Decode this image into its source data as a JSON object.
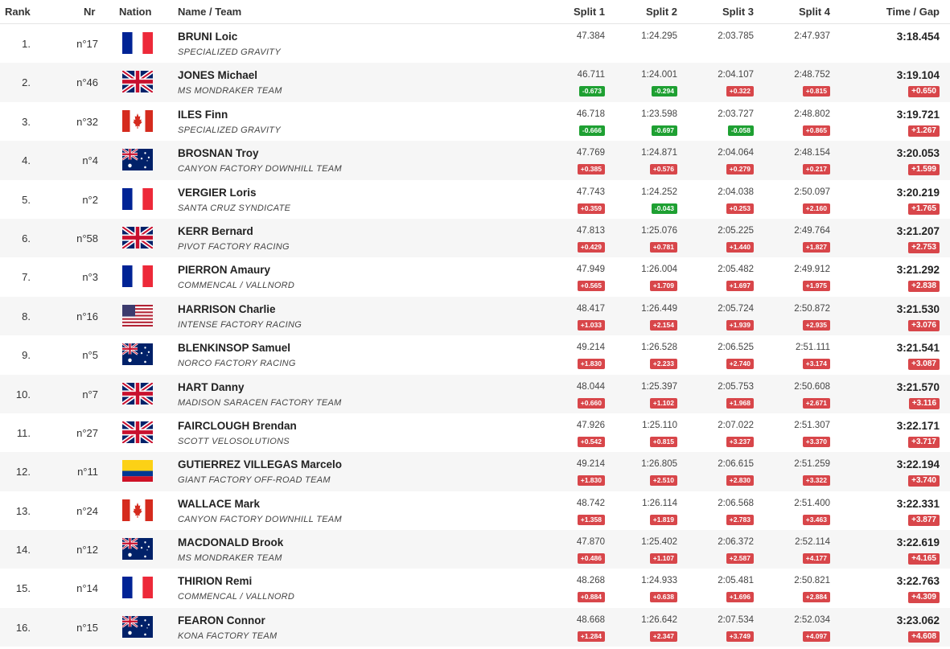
{
  "header": {
    "rank": "Rank",
    "nr": "Nr",
    "nation": "Nation",
    "name_team": "Name / Team",
    "split1": "Split 1",
    "split2": "Split 2",
    "split3": "Split 3",
    "split4": "Split 4",
    "time_gap": "Time / Gap"
  },
  "colors": {
    "behind": "#d8464a",
    "ahead": "#1ea032",
    "alt_row": "#f6f6f6"
  },
  "rows": [
    {
      "rank": "1.",
      "nr": "n°17",
      "nation": "fr",
      "name": "BRUNI Loic",
      "team": "SPECIALIZED GRAVITY",
      "s1": "47.384",
      "s1g": "",
      "s2": "1:24.295",
      "s2g": "",
      "s3": "2:03.785",
      "s3g": "",
      "s4": "2:47.937",
      "s4g": "",
      "time": "3:18.454",
      "gap": ""
    },
    {
      "rank": "2.",
      "nr": "n°46",
      "nation": "gb",
      "name": "JONES Michael",
      "team": "MS MONDRAKER TEAM",
      "s1": "46.711",
      "s1g": "-0.673",
      "s2": "1:24.001",
      "s2g": "-0.294",
      "s3": "2:04.107",
      "s3g": "+0.322",
      "s4": "2:48.752",
      "s4g": "+0.815",
      "time": "3:19.104",
      "gap": "+0.650"
    },
    {
      "rank": "3.",
      "nr": "n°32",
      "nation": "ca",
      "name": "ILES Finn",
      "team": "SPECIALIZED GRAVITY",
      "s1": "46.718",
      "s1g": "-0.666",
      "s2": "1:23.598",
      "s2g": "-0.697",
      "s3": "2:03.727",
      "s3g": "-0.058",
      "s4": "2:48.802",
      "s4g": "+0.865",
      "time": "3:19.721",
      "gap": "+1.267"
    },
    {
      "rank": "4.",
      "nr": "n°4",
      "nation": "au",
      "name": "BROSNAN Troy",
      "team": "CANYON FACTORY DOWNHILL TEAM",
      "s1": "47.769",
      "s1g": "+0.385",
      "s2": "1:24.871",
      "s2g": "+0.576",
      "s3": "2:04.064",
      "s3g": "+0.279",
      "s4": "2:48.154",
      "s4g": "+0.217",
      "time": "3:20.053",
      "gap": "+1.599"
    },
    {
      "rank": "5.",
      "nr": "n°2",
      "nation": "fr",
      "name": "VERGIER Loris",
      "team": "SANTA CRUZ SYNDICATE",
      "s1": "47.743",
      "s1g": "+0.359",
      "s2": "1:24.252",
      "s2g": "-0.043",
      "s3": "2:04.038",
      "s3g": "+0.253",
      "s4": "2:50.097",
      "s4g": "+2.160",
      "time": "3:20.219",
      "gap": "+1.765"
    },
    {
      "rank": "6.",
      "nr": "n°58",
      "nation": "gb",
      "name": "KERR Bernard",
      "team": "PIVOT FACTORY RACING",
      "s1": "47.813",
      "s1g": "+0.429",
      "s2": "1:25.076",
      "s2g": "+0.781",
      "s3": "2:05.225",
      "s3g": "+1.440",
      "s4": "2:49.764",
      "s4g": "+1.827",
      "time": "3:21.207",
      "gap": "+2.753"
    },
    {
      "rank": "7.",
      "nr": "n°3",
      "nation": "fr",
      "name": "PIERRON Amaury",
      "team": "COMMENCAL / VALLNORD",
      "s1": "47.949",
      "s1g": "+0.565",
      "s2": "1:26.004",
      "s2g": "+1.709",
      "s3": "2:05.482",
      "s3g": "+1.697",
      "s4": "2:49.912",
      "s4g": "+1.975",
      "time": "3:21.292",
      "gap": "+2.838"
    },
    {
      "rank": "8.",
      "nr": "n°16",
      "nation": "us",
      "name": "HARRISON Charlie",
      "team": "INTENSE FACTORY RACING",
      "s1": "48.417",
      "s1g": "+1.033",
      "s2": "1:26.449",
      "s2g": "+2.154",
      "s3": "2:05.724",
      "s3g": "+1.939",
      "s4": "2:50.872",
      "s4g": "+2.935",
      "time": "3:21.530",
      "gap": "+3.076"
    },
    {
      "rank": "9.",
      "nr": "n°5",
      "nation": "au",
      "name": "BLENKINSOP Samuel",
      "team": "NORCO FACTORY RACING",
      "s1": "49.214",
      "s1g": "+1.830",
      "s2": "1:26.528",
      "s2g": "+2.233",
      "s3": "2:06.525",
      "s3g": "+2.740",
      "s4": "2:51.111",
      "s4g": "+3.174",
      "time": "3:21.541",
      "gap": "+3.087"
    },
    {
      "rank": "10.",
      "nr": "n°7",
      "nation": "gb",
      "name": "HART Danny",
      "team": "MADISON SARACEN FACTORY TEAM",
      "s1": "48.044",
      "s1g": "+0.660",
      "s2": "1:25.397",
      "s2g": "+1.102",
      "s3": "2:05.753",
      "s3g": "+1.968",
      "s4": "2:50.608",
      "s4g": "+2.671",
      "time": "3:21.570",
      "gap": "+3.116"
    },
    {
      "rank": "11.",
      "nr": "n°27",
      "nation": "gb",
      "name": "FAIRCLOUGH Brendan",
      "team": "SCOTT VELOSOLUTIONS",
      "s1": "47.926",
      "s1g": "+0.542",
      "s2": "1:25.110",
      "s2g": "+0.815",
      "s3": "2:07.022",
      "s3g": "+3.237",
      "s4": "2:51.307",
      "s4g": "+3.370",
      "time": "3:22.171",
      "gap": "+3.717"
    },
    {
      "rank": "12.",
      "nr": "n°11",
      "nation": "co",
      "name": "GUTIERREZ VILLEGAS Marcelo",
      "team": "GIANT FACTORY OFF-ROAD TEAM",
      "s1": "49.214",
      "s1g": "+1.830",
      "s2": "1:26.805",
      "s2g": "+2.510",
      "s3": "2:06.615",
      "s3g": "+2.830",
      "s4": "2:51.259",
      "s4g": "+3.322",
      "time": "3:22.194",
      "gap": "+3.740"
    },
    {
      "rank": "13.",
      "nr": "n°24",
      "nation": "ca",
      "name": "WALLACE Mark",
      "team": "CANYON FACTORY DOWNHILL TEAM",
      "s1": "48.742",
      "s1g": "+1.358",
      "s2": "1:26.114",
      "s2g": "+1.819",
      "s3": "2:06.568",
      "s3g": "+2.783",
      "s4": "2:51.400",
      "s4g": "+3.463",
      "time": "3:22.331",
      "gap": "+3.877"
    },
    {
      "rank": "14.",
      "nr": "n°12",
      "nation": "au",
      "name": "MACDONALD Brook",
      "team": "MS MONDRAKER TEAM",
      "s1": "47.870",
      "s1g": "+0.486",
      "s2": "1:25.402",
      "s2g": "+1.107",
      "s3": "2:06.372",
      "s3g": "+2.587",
      "s4": "2:52.114",
      "s4g": "+4.177",
      "time": "3:22.619",
      "gap": "+4.165"
    },
    {
      "rank": "15.",
      "nr": "n°14",
      "nation": "fr",
      "name": "THIRION Remi",
      "team": "COMMENCAL / VALLNORD",
      "s1": "48.268",
      "s1g": "+0.884",
      "s2": "1:24.933",
      "s2g": "+0.638",
      "s3": "2:05.481",
      "s3g": "+1.696",
      "s4": "2:50.821",
      "s4g": "+2.884",
      "time": "3:22.763",
      "gap": "+4.309"
    },
    {
      "rank": "16.",
      "nr": "n°15",
      "nation": "au",
      "name": "FEARON Connor",
      "team": "KONA FACTORY TEAM",
      "s1": "48.668",
      "s1g": "+1.284",
      "s2": "1:26.642",
      "s2g": "+2.347",
      "s3": "2:07.534",
      "s3g": "+3.749",
      "s4": "2:52.034",
      "s4g": "+4.097",
      "time": "3:23.062",
      "gap": "+4.608"
    }
  ]
}
